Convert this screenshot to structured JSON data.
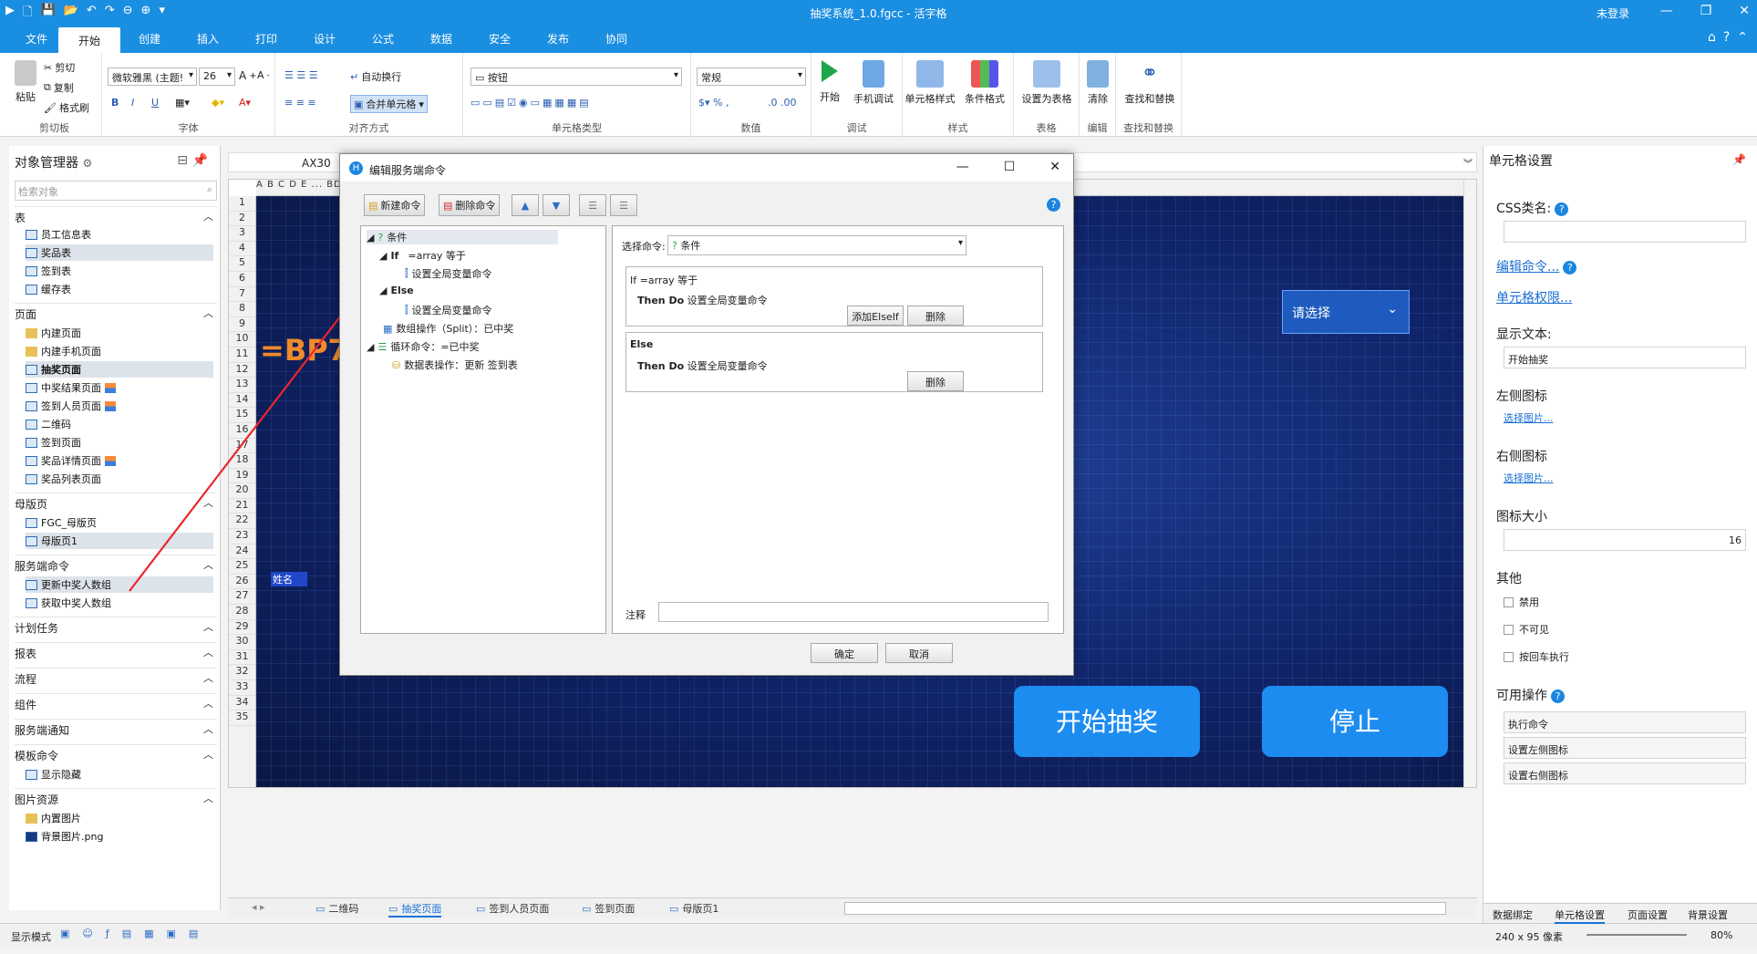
{
  "window": {
    "title": "抽奖系统_1.0.fgcc - 活字格",
    "login": "未登录"
  },
  "ribbon_tabs": [
    "文件",
    "开始",
    "创建",
    "插入",
    "打印",
    "设计",
    "公式",
    "数据",
    "安全",
    "发布",
    "协同"
  ],
  "ribbon": {
    "clipboard": {
      "paste": "粘贴",
      "cut": "剪切",
      "copy": "复制",
      "format_painter": "格式刷",
      "label": "剪切板"
    },
    "font": {
      "family": "微软雅黑 (主题!",
      "size": "26",
      "label": "字体"
    },
    "align": {
      "wrap": "自动换行",
      "merge": "合并单元格",
      "label": "对齐方式"
    },
    "celltype": {
      "type": "按钮",
      "label": "单元格类型"
    },
    "number": {
      "format": "常规",
      "label": "数值"
    },
    "debug": {
      "start": "开始",
      "mobile": "手机调试",
      "label": "调试"
    },
    "style": {
      "cell_style": "单元格样式",
      "cond_format": "条件格式",
      "label": "样式"
    },
    "table": {
      "set_table": "设置为表格",
      "label": "表格"
    },
    "edit": {
      "clear": "清除",
      "label": "编辑"
    },
    "find": {
      "find_replace": "查找和替换",
      "label": "查找和替换"
    }
  },
  "left": {
    "title": "对象管理器",
    "search_placeholder": "检索对象",
    "sec_tables": "表",
    "tables": [
      "员工信息表",
      "奖品表",
      "签到表",
      "缓存表"
    ],
    "sec_pages": "页面",
    "pages": [
      "内建页面",
      "内建手机页面",
      "抽奖页面",
      "中奖结果页面",
      "签到人员页面",
      "二维码",
      "签到页面",
      "奖品详情页面",
      "奖品列表页面"
    ],
    "sec_master": "母版页",
    "masters": [
      "FGC_母版页",
      "母版页1"
    ],
    "sec_server": "服务端命令",
    "server": [
      "更新中奖人数组",
      "获取中奖人数组"
    ],
    "sec_sched": "计划任务",
    "sec_report": "报表",
    "sec_flow": "流程",
    "sec_comp": "组件",
    "sec_notify": "服务端通知",
    "sec_template": "模板命令",
    "templates": [
      "显示隐藏"
    ],
    "sec_images": "图片资源",
    "images": [
      "内置图片",
      "背景图片.png"
    ]
  },
  "formula": {
    "cell": "AX30"
  },
  "grid": {
    "col_headers": "A B C D E ... BD BE BF BG BH BI BJ BK BL BM BN BO BP BQ BR BS BT BU BV BW BX BY BZ",
    "rows": [
      "1",
      "2",
      "3",
      "4",
      "5",
      "6",
      "7",
      "8",
      "9",
      "10",
      "11",
      "12",
      "13",
      "14",
      "15",
      "16",
      "17",
      "18",
      "19",
      "20",
      "21",
      "22",
      "23",
      "24",
      "25",
      "26",
      "27",
      "28",
      "29",
      "30",
      "31",
      "32",
      "33",
      "34",
      "35"
    ],
    "formula_text": "=BP7",
    "name_label": "姓名",
    "dropdown": "请选择",
    "start_btn": "开始抽奖",
    "stop_btn": "停止"
  },
  "sheet_tabs": [
    "二维码",
    "抽奖页面",
    "签到人员页面",
    "签到页面",
    "母版页1"
  ],
  "status": {
    "mode": "显示模式",
    "size": "240 x 95 像素",
    "zoom": "80%"
  },
  "right": {
    "title": "单元格设置",
    "css_label": "CSS类名:",
    "edit_cmd": "编辑命令...",
    "cell_perm": "单元格权限...",
    "display_label": "显示文本:",
    "display_value": "开始抽奖",
    "left_icon": "左侧图标",
    "right_icon": "右侧图标",
    "choose_img": "选择图片...",
    "icon_size_label": "图标大小",
    "icon_size": "16",
    "other": "其他",
    "disabled": "禁用",
    "invisible": "不可见",
    "enter_exec": "按回车执行",
    "ops": "可用操作",
    "op_list": [
      "执行命令",
      "设置左侧图标",
      "设置右侧图标"
    ],
    "bottom_tabs": [
      "数据绑定",
      "单元格设置",
      "页面设置",
      "背景设置"
    ]
  },
  "dialog": {
    "title": "编辑服务端命令",
    "new_cmd": "新建命令",
    "del_cmd": "删除命令",
    "tree": {
      "cond": "条件",
      "if": "If",
      "if_expr": "=array 等于",
      "set_global1": "设置全局变量命令",
      "else": "Else",
      "set_global2": "设置全局变量命令",
      "array_op": "数组操作（Split）：已中奖",
      "loop": "循环命令：=已中奖",
      "table_op": "数据表操作：更新 签到表"
    },
    "select_label": "选择命令:",
    "select_value": "条件",
    "if_line": "If =array 等于",
    "then_label": "Then Do",
    "then_cmd": "设置全局变量命令",
    "add_elseif": "添加ElseIf",
    "delete": "删除",
    "else_line": "Else",
    "comment_label": "注释",
    "ok": "确定",
    "cancel": "取消"
  }
}
